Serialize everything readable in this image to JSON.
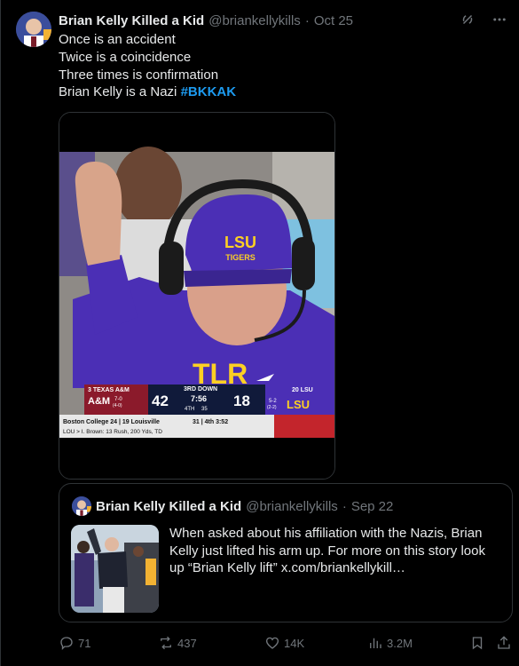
{
  "post": {
    "author_name": "Brian Kelly Killed a Kid",
    "handle": "@briankellykills",
    "separator": "·",
    "date": "Oct 25",
    "text_lines": [
      "Once is an accident",
      "Twice is a coincidence",
      "Three times is confirmation",
      "Brian Kelly is a Nazi"
    ],
    "hashtag": "#BKKAK"
  },
  "scoreboard": {
    "away_team_line": "3 TEXAS A&M",
    "away_abbrev": "A&M",
    "away_record": "7-0",
    "away_conf_record": "(4-0)",
    "away_score": "42",
    "down": "3RD DOWN",
    "clock": "7:56",
    "quarter": "4TH",
    "distance": "35",
    "home_score": "18",
    "home_team_line": "20 LSU",
    "home_record": "5-2",
    "home_conf_record": "(2-2)",
    "home_abbrev": "LSU",
    "ticker_line1": "Boston College  24 | 19 Louisville",
    "ticker_line1_right": "31 | 4th 3:52",
    "ticker_line2": "LOU > I. Brown: 13 Rush, 200 Yds, TD",
    "cap_logo": "LSU",
    "cap_logo_sub": "TIGERS",
    "shirt_text": "TLR"
  },
  "quote": {
    "author_name": "Brian Kelly Killed a Kid",
    "handle": "@briankellykills",
    "separator": "·",
    "date": "Sep 22",
    "text": "When asked about his affiliation with the Nazis, Brian Kelly just lifted his arm up. For more on this story look up “Brian Kelly lift”  x.com/briankellykill…"
  },
  "actions": {
    "replies": "71",
    "reposts": "437",
    "likes": "14K",
    "views": "3.2M"
  },
  "icons": [
    "grok-icon",
    "more-icon",
    "reply-icon",
    "repost-icon",
    "like-icon",
    "views-icon",
    "bookmark-icon",
    "share-icon"
  ],
  "colors": {
    "background": "#000000",
    "text": "#e7e9ea",
    "muted": "#71767b",
    "accent": "#1d9bf0",
    "border": "#2f3336",
    "lsu_purple": "#4b2fb5",
    "lsu_gold": "#fdd023"
  }
}
